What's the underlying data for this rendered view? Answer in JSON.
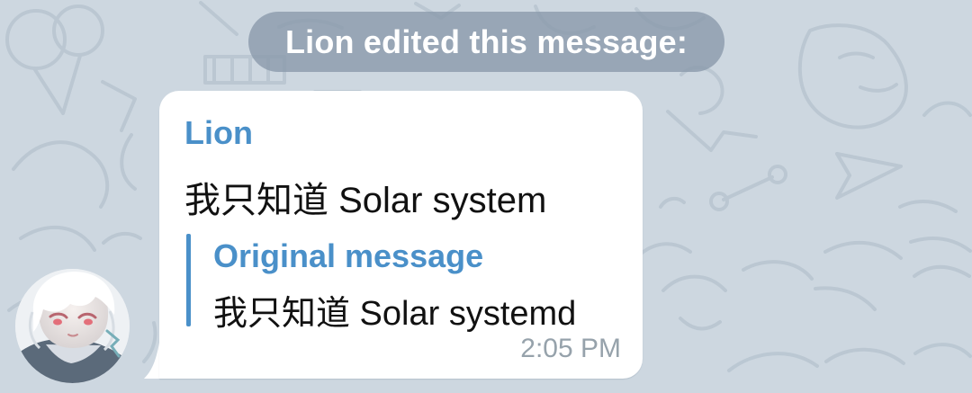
{
  "service_message": {
    "text": "Lion edited this message:"
  },
  "message": {
    "sender": "Lion",
    "text": "我只知道 Solar system",
    "quote": {
      "title": "Original message",
      "text": "我只知道 Solar systemd"
    },
    "time": "2:05 PM"
  },
  "colors": {
    "background": "#cdd7e0",
    "pattern": "#b7c4cf",
    "service_pill": "#8999aa",
    "accent": "#4a90c9",
    "bubble": "#ffffff",
    "timestamp": "#96a2ab"
  },
  "icons": {
    "wallpaper": "doodle-pattern",
    "avatar": "anime-character-avatar"
  }
}
